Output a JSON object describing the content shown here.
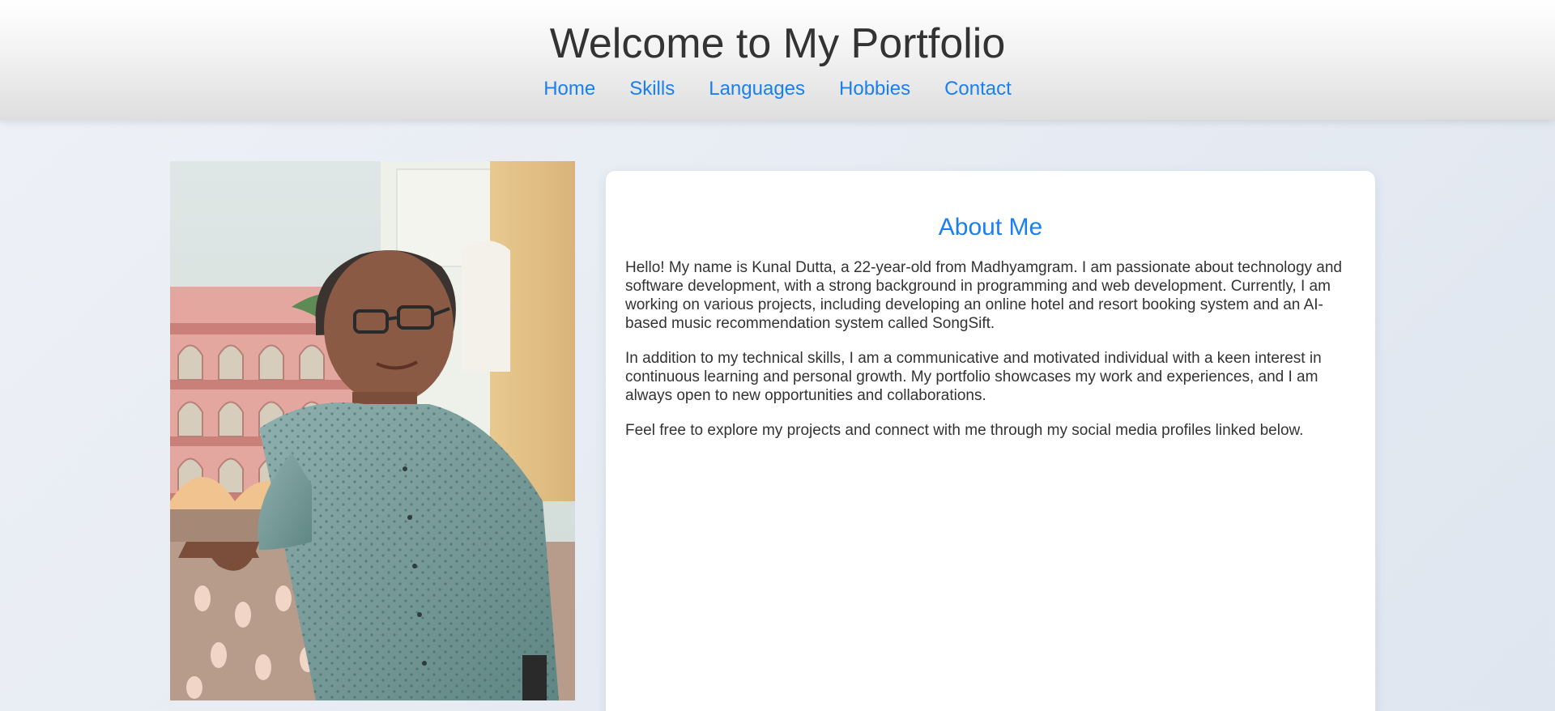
{
  "header": {
    "title": "Welcome to My Portfolio",
    "nav": [
      {
        "label": "Home"
      },
      {
        "label": "Skills"
      },
      {
        "label": "Languages"
      },
      {
        "label": "Hobbies"
      },
      {
        "label": "Contact"
      }
    ]
  },
  "profile_photo": {
    "icon": "profile-photo"
  },
  "about": {
    "heading": "About Me",
    "paragraphs": [
      "Hello! My name is Kunal Dutta, a 22-year-old from Madhyamgram. I am passionate about technology and software development, with a strong background in programming and web development. Currently, I am working on various projects, including developing an online hotel and resort booking system and an AI-based music recommendation system called SongSift.",
      "In addition to my technical skills, I am a communicative and motivated individual with a keen interest in continuous learning and personal growth. My portfolio showcases my work and experiences, and I am always open to new opportunities and collaborations.",
      "Feel free to explore my projects and connect with me through my social media profiles linked below."
    ]
  },
  "colors": {
    "accent": "#1a7ff0",
    "title_text": "#333333",
    "body_text": "#333333",
    "card_background": "#ffffff",
    "page_background": "#e9edf4"
  }
}
